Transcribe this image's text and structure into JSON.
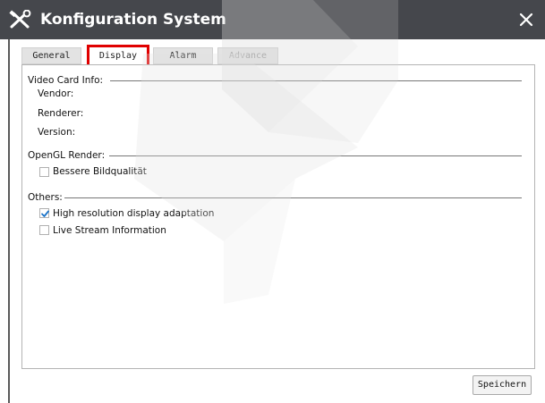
{
  "window": {
    "title": "Konfiguration System",
    "title_icon": "tools-icon",
    "close_icon": "close-icon"
  },
  "tabs": [
    {
      "label": "General",
      "state": "normal"
    },
    {
      "label": "Display",
      "state": "active"
    },
    {
      "label": "Alarm",
      "state": "normal"
    },
    {
      "label": "Advance",
      "state": "disabled"
    }
  ],
  "sections": {
    "video_card": {
      "title": "Video Card Info:",
      "vendor_label": "Vendor:",
      "renderer_label": "Renderer:",
      "version_label": "Version:"
    },
    "opengl": {
      "title": "OpenGL Render:",
      "better_quality": {
        "label": "Bessere Bildqualität",
        "checked": false
      }
    },
    "others": {
      "title": "Others:",
      "high_res": {
        "label": "High resolution display adaptation",
        "checked": true
      },
      "live_stream": {
        "label": "Live Stream Information",
        "checked": false
      }
    }
  },
  "buttons": {
    "save_label": "Speichern"
  },
  "colors": {
    "titlebar": "#45474c",
    "tab_highlight": "#e00000",
    "check": "#1a73c8"
  }
}
